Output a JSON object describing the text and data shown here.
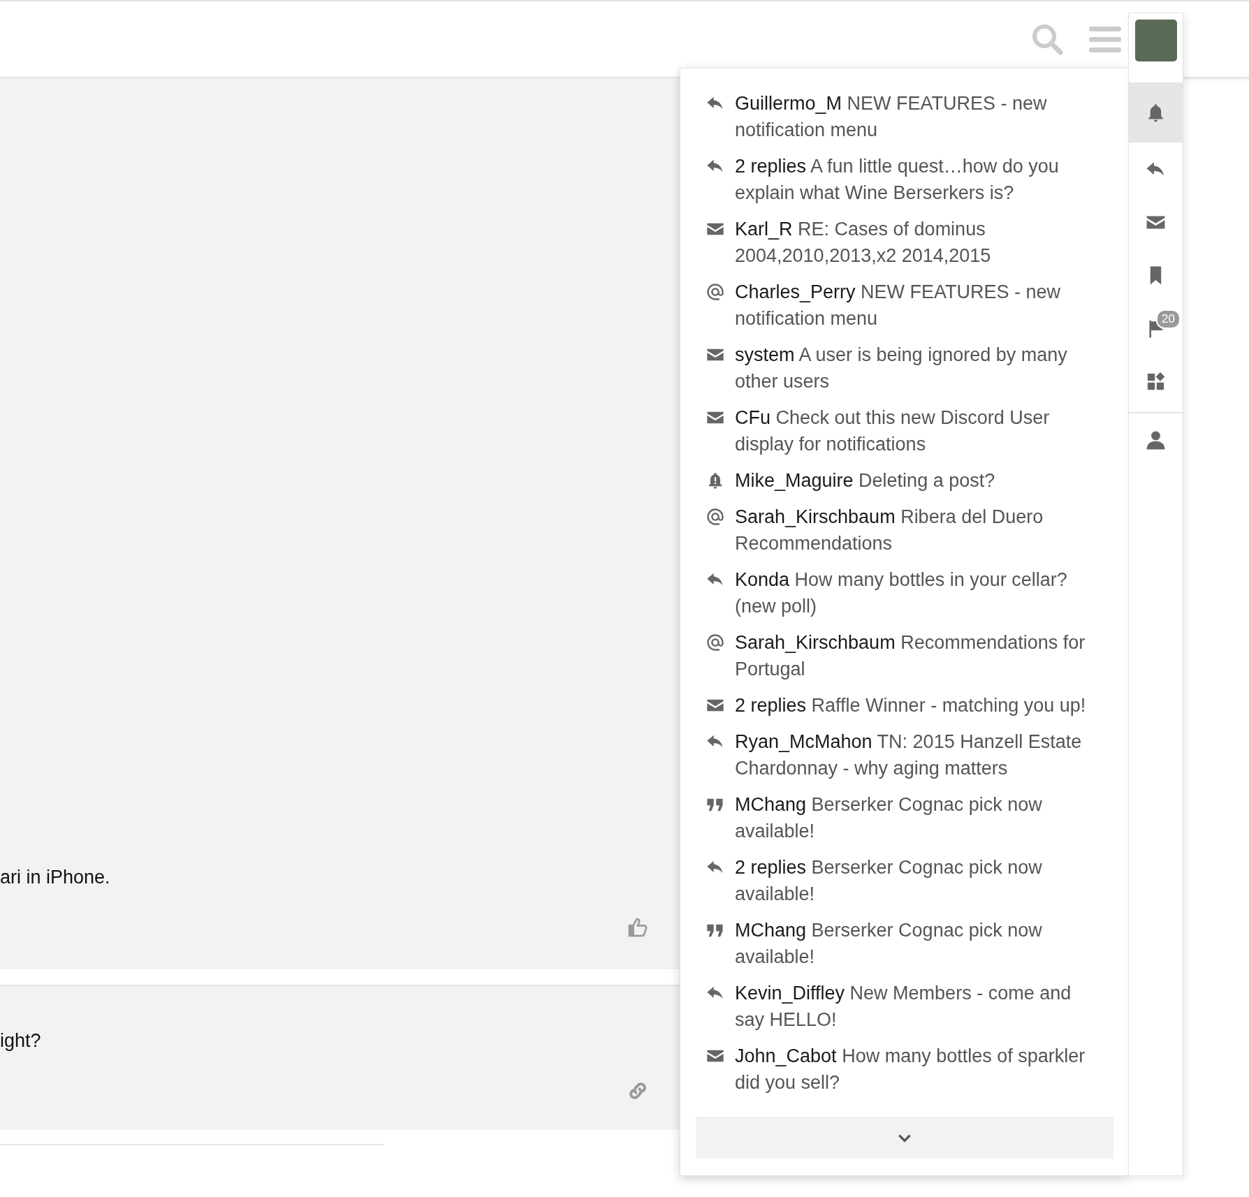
{
  "posts": [
    {
      "text": "ari in iPhone.",
      "kind": "like"
    },
    {
      "text": "ight?",
      "kind": "link"
    }
  ],
  "sidebar": {
    "tabs": [
      {
        "kind": "bell",
        "selected": true
      },
      {
        "kind": "reply",
        "selected": false
      },
      {
        "kind": "mail",
        "selected": false
      },
      {
        "kind": "bookmark",
        "selected": false
      },
      {
        "kind": "flag",
        "selected": false,
        "badge": "20"
      },
      {
        "kind": "grid",
        "selected": false
      }
    ],
    "bottom_tabs": [
      {
        "kind": "user",
        "selected": false
      }
    ]
  },
  "notifications": [
    {
      "kind": "reply",
      "user": "Guillermo_M",
      "title": "NEW FEATURES - new notification menu"
    },
    {
      "kind": "reply",
      "user": "2 replies",
      "title": "A fun little quest…how do you explain what Wine Berserkers is?"
    },
    {
      "kind": "mail",
      "user": "Karl_R",
      "title": "RE: Cases of dominus 2004,2010,2013,x2 2014,2015"
    },
    {
      "kind": "mention",
      "user": "Charles_Perry",
      "title": "NEW FEATURES - new notification menu"
    },
    {
      "kind": "mail",
      "user": "system",
      "title": "A user is being ignored by many other users"
    },
    {
      "kind": "mail",
      "user": "CFu",
      "title": "Check out this new Discord User display for notifications"
    },
    {
      "kind": "alert",
      "user": "Mike_Maguire",
      "title": "Deleting a post?"
    },
    {
      "kind": "mention",
      "user": "Sarah_Kirschbaum",
      "title": "Ribera del Duero Recommendations"
    },
    {
      "kind": "reply",
      "user": "Konda",
      "title": "How many bottles in your cellar? (new poll)"
    },
    {
      "kind": "mention",
      "user": "Sarah_Kirschbaum",
      "title": "Recommendations for Portugal"
    },
    {
      "kind": "mail",
      "user": "2 replies",
      "title": "Raffle Winner - matching you up!"
    },
    {
      "kind": "reply",
      "user": "Ryan_McMahon",
      "title": "TN: 2015 Hanzell Estate Chardonnay - why aging matters"
    },
    {
      "kind": "quote",
      "user": "MChang",
      "title": "Berserker Cognac pick now available!"
    },
    {
      "kind": "reply",
      "user": "2 replies",
      "title": "Berserker Cognac pick now available!"
    },
    {
      "kind": "quote",
      "user": "MChang",
      "title": "Berserker Cognac pick now available!"
    },
    {
      "kind": "reply",
      "user": "Kevin_Diffley",
      "title": "New Members - come and say HELLO!"
    },
    {
      "kind": "mail",
      "user": "John_Cabot",
      "title": "How many bottles of sparkler did you sell?"
    }
  ]
}
